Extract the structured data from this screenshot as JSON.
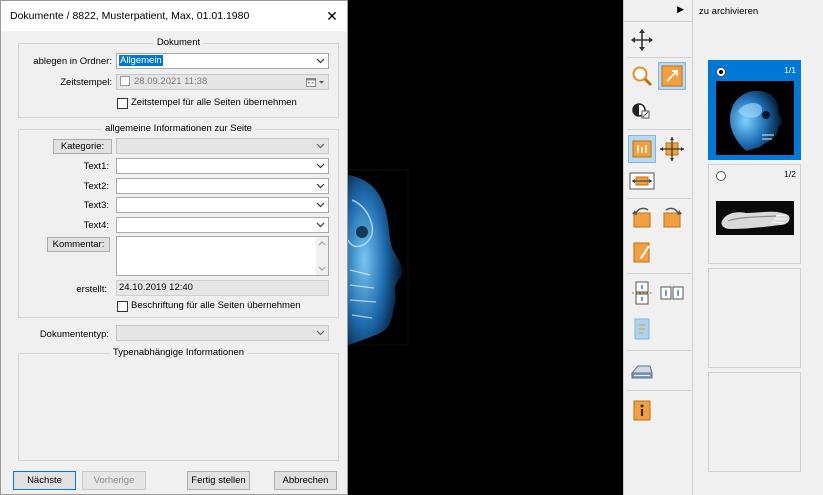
{
  "dialog": {
    "title": "Dokumente / 8822, Musterpatient, Max, 01.01.1980",
    "close_glyph": "✕"
  },
  "document_group": {
    "title": "Dokument",
    "folder_label": "ablegen in Ordner:",
    "folder_value": "Allgemein",
    "timestamp_label": "Zeitstempel:",
    "timestamp_value": "28.09.2021 11:38",
    "timestamp_all_pages_label": "Zeitstempel für alle Seiten übernehmen",
    "timestamp_all_pages_checked": false
  },
  "page_info_group": {
    "title": "allgemeine Informationen zur Seite",
    "category_button": "Kategorie:",
    "category_value": "",
    "text1_label": "Text1:",
    "text2_label": "Text2:",
    "text3_label": "Text3:",
    "text4_label": "Text4:",
    "comment_button": "Kommentar:",
    "comment_value": "",
    "created_label": "erstellt:",
    "created_value": "24.10.2019 12:40",
    "caption_all_pages_label": "Beschriftung für alle Seiten übernehmen",
    "caption_all_pages_checked": false
  },
  "document_type": {
    "label": "Dokumententyp:",
    "value": ""
  },
  "type_info_group": {
    "title": "Typenabhängige Informationen"
  },
  "footer": {
    "next_label": "Nächste",
    "previous_label": "Vorherige",
    "finish_label": "Fertig stellen",
    "cancel_label": "Abbrechen"
  },
  "toolbar": {
    "collapse_glyph": "▶",
    "tools": [
      "move-icon",
      "zoom-icon",
      "crop-icon",
      "contrast-icon",
      "fit-height-icon",
      "fit-all-icon",
      "fit-width-icon",
      "rotate-left-icon",
      "rotate-right-icon",
      "edit-page-icon",
      "split-page-icon",
      "merge-pages-icon",
      "scanner-icon",
      "info-icon"
    ]
  },
  "thumbnails": {
    "header": "zu archivieren",
    "items": [
      {
        "page": "1/1",
        "selected": true,
        "image": "head-xray"
      },
      {
        "page": "1/2",
        "selected": false,
        "image": "foot-xray"
      }
    ]
  },
  "colors": {
    "selection": "#0078d7",
    "toolbar_active": "#b9d9f3",
    "tool_orange": "#f0a040"
  }
}
